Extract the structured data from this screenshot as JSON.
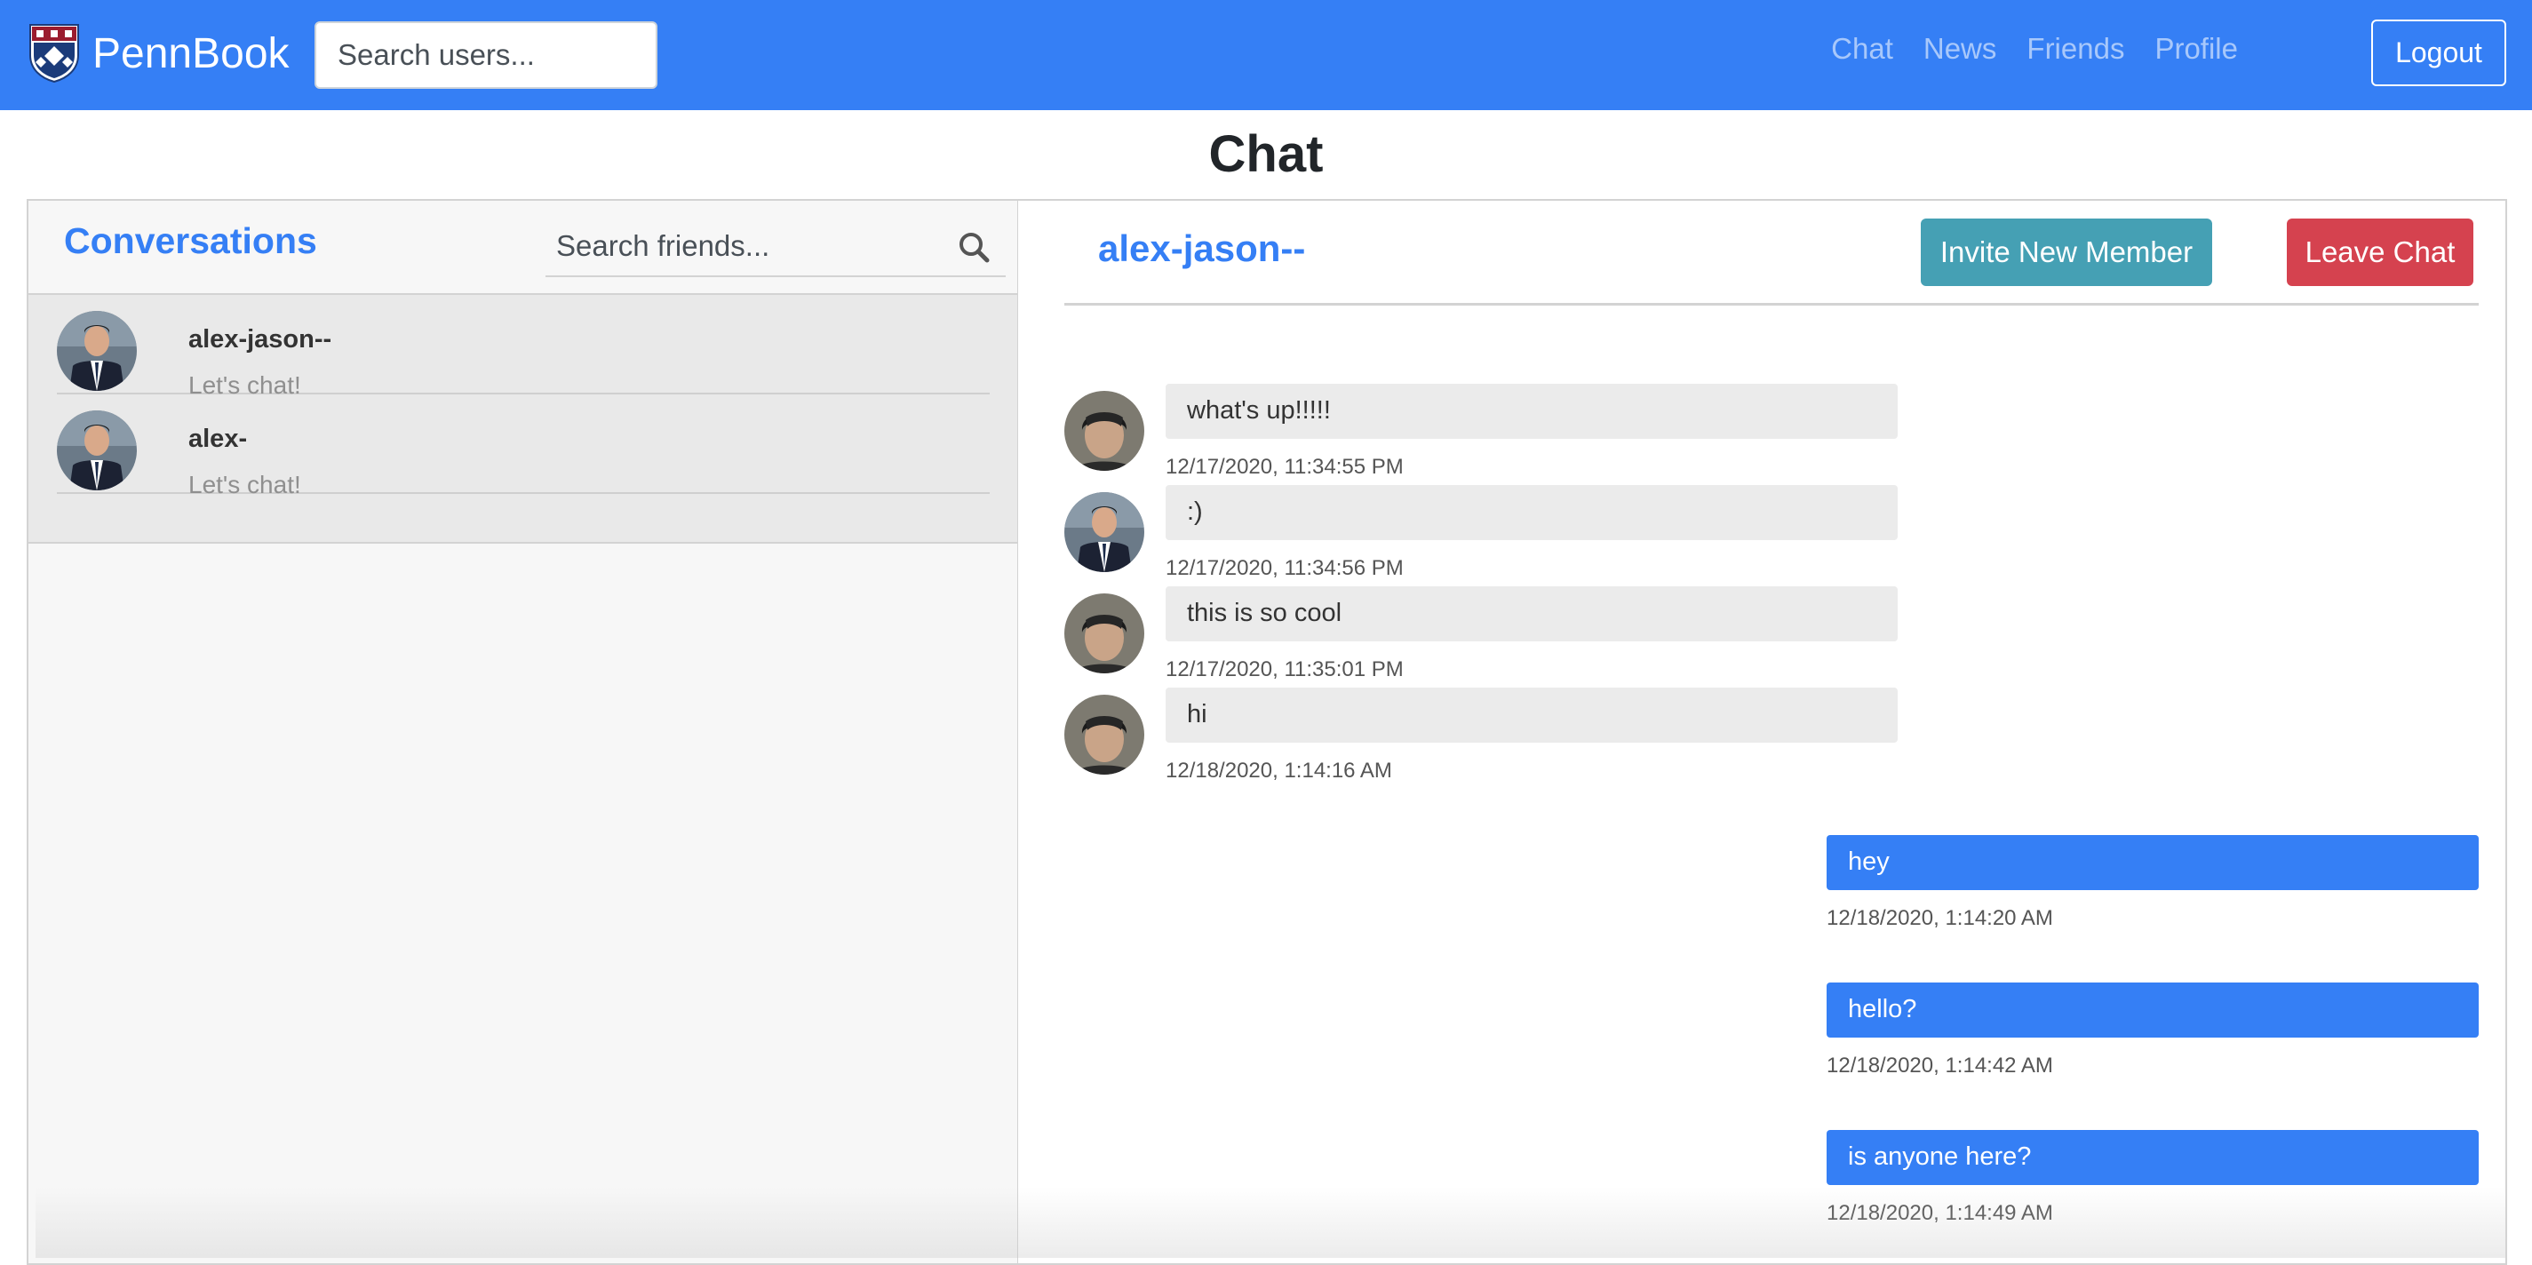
{
  "navbar": {
    "brand": "PennBook",
    "search_placeholder": "Search users...",
    "links": [
      "Chat",
      "News",
      "Friends",
      "Profile"
    ],
    "logout_label": "Logout",
    "bg_color": "#357ff5"
  },
  "page": {
    "title": "Chat"
  },
  "conversations": {
    "title": "Conversations",
    "search_placeholder": "Search friends...",
    "items": [
      {
        "name": "alex-jason--",
        "preview": "Let's chat!",
        "selected": true
      },
      {
        "name": "alex-",
        "preview": "Let's chat!",
        "selected": false
      }
    ]
  },
  "chat": {
    "name": "alex-jason--",
    "invite_label": "Invite New Member",
    "leave_label": "Leave Chat",
    "invite_color": "#45a0b4",
    "leave_color": "#d5424f",
    "incoming": [
      {
        "text": "what's up!!!!!",
        "time": "12/17/2020, 11:34:55 PM",
        "avatar": "avatar-photo-icon"
      },
      {
        "text": ":)",
        "time": "12/17/2020, 11:34:56 PM",
        "avatar": "avatar-suit-icon"
      },
      {
        "text": "this is so cool",
        "time": "12/17/2020, 11:35:01 PM",
        "avatar": "avatar-photo-icon"
      },
      {
        "text": "hi",
        "time": "12/18/2020, 1:14:16 AM",
        "avatar": "avatar-photo-icon"
      }
    ],
    "outgoing": [
      {
        "text": "hey",
        "time": "12/18/2020, 1:14:20 AM"
      },
      {
        "text": "hello?",
        "time": "12/18/2020, 1:14:42 AM"
      },
      {
        "text": "is anyone here?",
        "time": "12/18/2020, 1:14:49 AM"
      }
    ]
  }
}
